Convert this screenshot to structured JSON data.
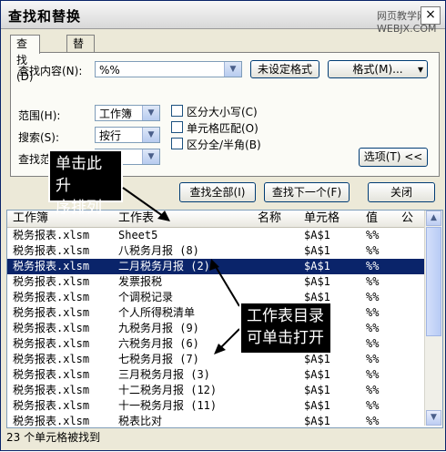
{
  "dialog": {
    "title": "查找和替换",
    "close_glyph": "×",
    "watermark": "网页教学网 WEBJX.COM"
  },
  "tabs": [
    {
      "label": "查找(D)"
    },
    {
      "label": "替换(P)"
    }
  ],
  "find": {
    "label": "查找内容(N):",
    "value": "%%",
    "format_status": "未设定格式",
    "format_button": "格式(M)...",
    "format_dropdown_glyph": "▾"
  },
  "options": {
    "scope_label": "范围(H):",
    "scope_value": "工作簿",
    "search_label": "搜索(S):",
    "search_value": "按行",
    "lookin_label": "查找范",
    "lookin_value": "",
    "match_case": "区分大小写(C)",
    "match_whole": "单元格匹配(O)",
    "match_byte": "区分全/半角(B)",
    "options_button": "选项(T) <<"
  },
  "buttons": {
    "find_all": "查找全部(I)",
    "find_next": "查找下一个(F)",
    "close": "关闭"
  },
  "callouts": {
    "sort": "单击此升\n序排列",
    "open": "工作表目录\n可单击打开"
  },
  "list": {
    "columns": [
      "工作簿",
      "工作表",
      "名称",
      "单元格",
      "值",
      "公"
    ],
    "rows": [
      [
        "税务报表.xlsm",
        "Sheet5",
        "",
        "$A$1",
        "%%"
      ],
      [
        "税务报表.xlsm",
        "八税务月报 (8)",
        "",
        "$A$1",
        "%%"
      ],
      [
        "税务报表.xlsm",
        "二月税务月报 (2)",
        "",
        "$A$1",
        "%%"
      ],
      [
        "税务报表.xlsm",
        "发票报税",
        "",
        "$A$1",
        "%%"
      ],
      [
        "税务报表.xlsm",
        "个调税记录",
        "",
        "$A$1",
        "%%"
      ],
      [
        "税务报表.xlsm",
        "个人所得税清单",
        "",
        "$A$1",
        "%%"
      ],
      [
        "税务报表.xlsm",
        "九税务月报 (9)",
        "",
        "$A$1",
        "%%"
      ],
      [
        "税务报表.xlsm",
        "六税务月报 (6)",
        "",
        "$A$1",
        "%%"
      ],
      [
        "税务报表.xlsm",
        "七税务月报 (7)",
        "",
        "$A$1",
        "%%"
      ],
      [
        "税务报表.xlsm",
        "三月税务月报 (3)",
        "",
        "$A$1",
        "%%"
      ],
      [
        "税务报表.xlsm",
        "十二税务月报 (12)",
        "",
        "$A$1",
        "%%"
      ],
      [
        "税务报表.xlsm",
        "十一税务月报 (11)",
        "",
        "$A$1",
        "%%"
      ],
      [
        "税务报表.xlsm",
        "税表比对",
        "",
        "$A$1",
        "%%"
      ],
      [
        "税务报表.xlsm",
        "税表比对查印",
        "",
        "$A$1",
        "%%"
      ]
    ],
    "selected_index": 2
  },
  "status": "23 个单元格被找到",
  "colors": {
    "selection": "#0a246a",
    "dialog_bg": "#ece9d8"
  }
}
